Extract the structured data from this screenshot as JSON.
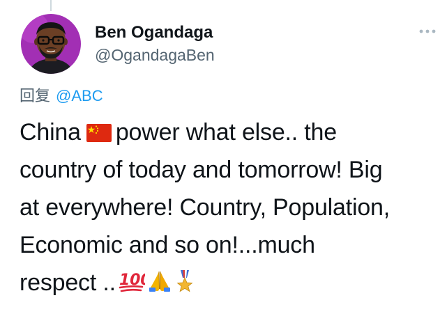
{
  "tweet": {
    "author": {
      "display_name": "Ben Ogandaga",
      "handle": "@OgandagaBen",
      "avatar_icon": "avatar-illustration"
    },
    "more_icon": "more-horizontal-icon",
    "reply_prefix": "回复",
    "reply_to": "@ABC",
    "lines": [
      {
        "before": "China",
        "after": "power what else.. the"
      },
      {
        "text": "country of today and tomorrow! Big"
      },
      {
        "text": "at everywhere! Country, Population,"
      },
      {
        "text": "Economic and so on!...much"
      },
      {
        "text": "respect .."
      }
    ],
    "emojis": [
      "china-flag-icon",
      "hundred-points-icon",
      "folded-hands-icon",
      "military-medal-icon"
    ],
    "colors": {
      "text": "#0f1419",
      "secondary": "#536471",
      "link": "#1d9bf0",
      "avatar_bg": "#a22fb4"
    }
  }
}
